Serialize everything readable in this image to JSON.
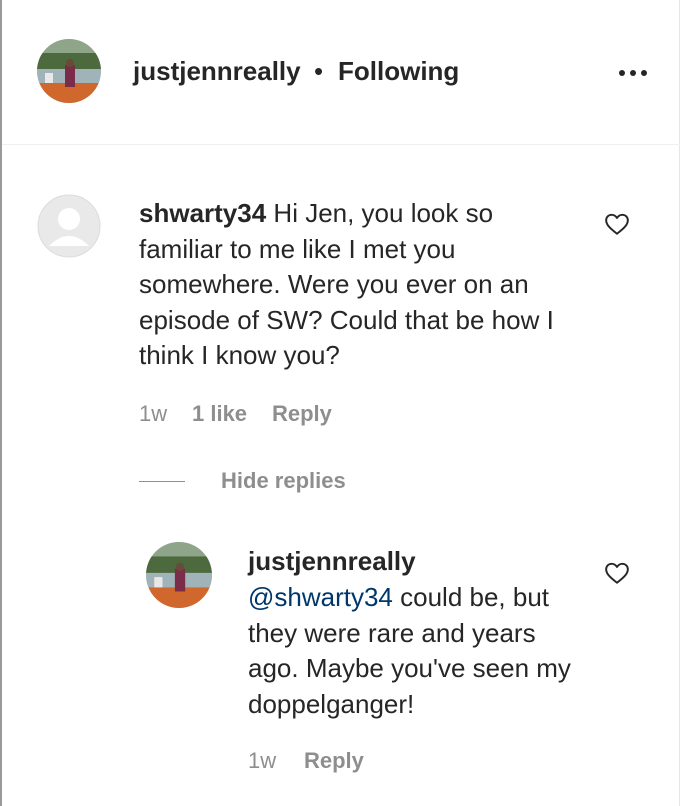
{
  "header": {
    "username": "justjennreally",
    "separator": "•",
    "follow_status": "Following",
    "more_icon": "more-horizontal-icon"
  },
  "comment": {
    "username": "shwarty34",
    "text": " Hi Jen, you look so familiar to me like I met you somewhere. Were you ever on an episode of SW? Could that be how I think I know you?",
    "time": "1w",
    "likes": "1 like",
    "reply_label": "Reply",
    "like_icon": "heart-outline-icon"
  },
  "replies_toggle": {
    "label": "Hide replies"
  },
  "reply": {
    "username": "justjennreally",
    "mention": "@shwarty34",
    "text": " could be, but they were rare and years ago. Maybe you've seen my doppelganger!",
    "time": "1w",
    "reply_label": "Reply",
    "like_icon": "heart-outline-icon"
  },
  "colors": {
    "text": "#262626",
    "muted": "#8e8e8e",
    "mention": "#00376b",
    "divider": "#efefef"
  }
}
